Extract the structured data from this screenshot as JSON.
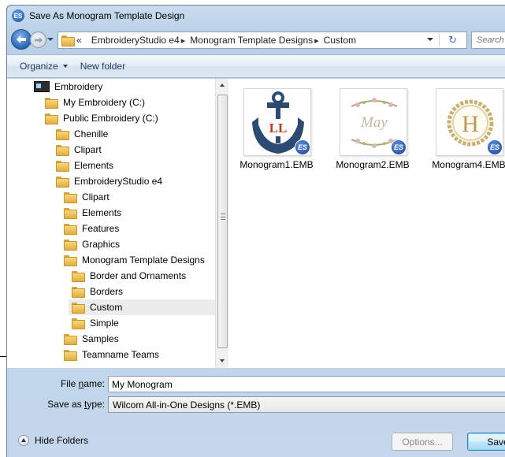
{
  "window": {
    "title": "Save As Monogram Template Design",
    "app_icon_text": "ES"
  },
  "address": {
    "prefix": "«",
    "crumbs": [
      "EmbroideryStudio e4",
      "Monogram Template Designs",
      "Custom"
    ],
    "search_placeholder": "Search C"
  },
  "toolbar": {
    "organize_label": "Organize",
    "new_folder_label": "New folder"
  },
  "tree": {
    "items": [
      {
        "label": "Embroidery",
        "icon": "embroidery-library-icon"
      },
      {
        "label": "My Embroidery (C:)",
        "icon": "folder-icon"
      },
      {
        "label": "Public Embroidery (C:)",
        "icon": "folder-icon"
      },
      {
        "label": "Chenille",
        "icon": "folder-icon"
      },
      {
        "label": "Clipart",
        "icon": "folder-icon"
      },
      {
        "label": "Elements",
        "icon": "folder-icon"
      },
      {
        "label": "EmbroideryStudio e4",
        "icon": "folder-icon"
      },
      {
        "label": "Clipart",
        "icon": "folder-icon"
      },
      {
        "label": "Elements",
        "icon": "folder-icon"
      },
      {
        "label": "Features",
        "icon": "folder-icon"
      },
      {
        "label": "Graphics",
        "icon": "folder-icon"
      },
      {
        "label": "Monogram Template Designs",
        "icon": "folder-icon"
      },
      {
        "label": "Border and Ornaments",
        "icon": "folder-icon"
      },
      {
        "label": "Borders",
        "icon": "folder-icon"
      },
      {
        "label": "Custom",
        "icon": "folder-icon",
        "selected": true
      },
      {
        "label": "Simple",
        "icon": "folder-icon"
      },
      {
        "label": "Samples",
        "icon": "folder-icon"
      },
      {
        "label": "Teamname Teams",
        "icon": "folder-icon"
      }
    ]
  },
  "files": [
    {
      "name": "Monogram1.EMB",
      "thumb_text": "LL",
      "badge": "ES"
    },
    {
      "name": "Monogram2.EMB",
      "thumb_text": "May",
      "badge": "ES"
    },
    {
      "name": "Monogram4.EMB",
      "thumb_text": "H",
      "badge": "ES"
    }
  ],
  "form": {
    "filename_label_pre": "File ",
    "filename_label_u": "n",
    "filename_label_post": "ame:",
    "filename_value": "My Monogram",
    "savetype_label_pre": "Save as ",
    "savetype_label_u": "t",
    "savetype_label_post": "ype:",
    "savetype_value": "Wilcom All-in-One Designs (*.EMB)"
  },
  "footer": {
    "hide_folders_label": "Hide Folders",
    "options_label": "Options...",
    "save_label": "Save"
  },
  "colors": {
    "chrome_blue": "#bcd1e8",
    "folder_yellow": "#f2c95c",
    "anchor_navy": "#2c4a72",
    "monogram_red": "#c0392b",
    "wreath_gold": "#c9b070"
  }
}
